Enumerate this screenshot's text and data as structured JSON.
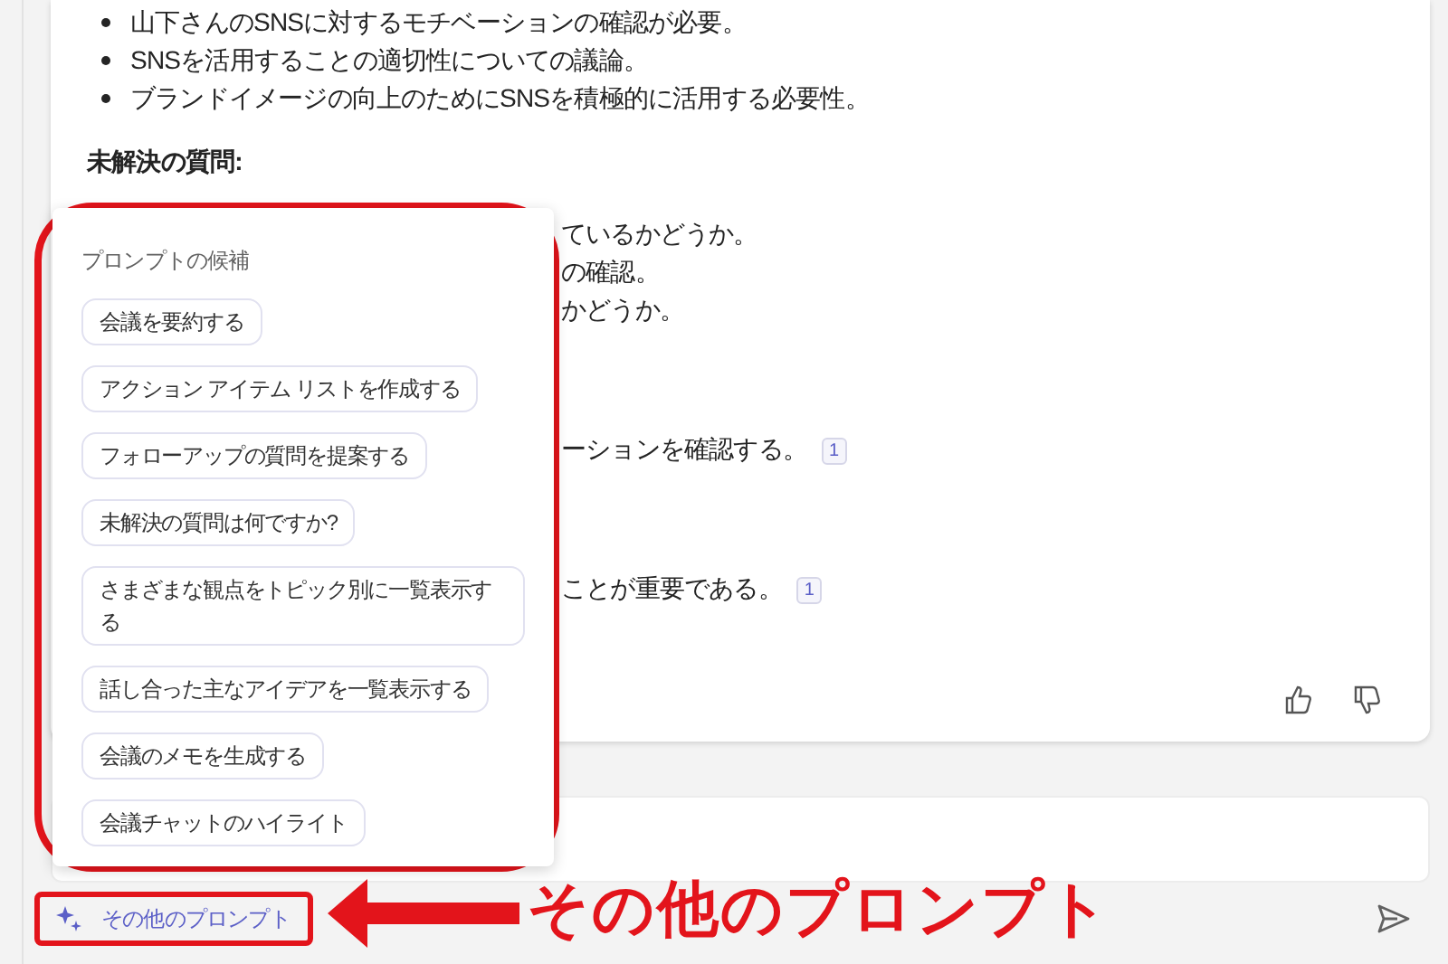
{
  "message": {
    "lines": [
      {
        "kind": "bullet",
        "text": "山下さんのSNSに対するモチベーションの確認が必要。"
      },
      {
        "kind": "bullet",
        "text": "SNSを活用することの適切性についての議論。"
      },
      {
        "kind": "bullet",
        "text": "ブランドイメージの向上のためにSNSを積極的に活用する必要性。"
      },
      {
        "kind": "heading",
        "text": "未解決の質問:"
      },
      {
        "kind": "fragment",
        "text": "ているかどうか。"
      },
      {
        "kind": "fragment",
        "text": "の確認。"
      },
      {
        "kind": "fragment",
        "text": "かどうか。"
      },
      {
        "kind": "fragment",
        "text": "ーションを確認する。",
        "citation": "1"
      },
      {
        "kind": "fragment",
        "text": "ことが重要である。",
        "citation": "1"
      }
    ]
  },
  "prompt_suggestions": {
    "title": "プロンプトの候補",
    "chips": [
      "会議を要約する",
      "アクション アイテム リストを作成する",
      "フォローアップの質問を提案する",
      "未解決の質問は何ですか?",
      "さまざまな観点をトピック別に一覧表示する",
      "話し合った主なアイデアを一覧表示する",
      "会議のメモを生成する",
      "会議チャットのハイライト"
    ]
  },
  "compose": {
    "more_prompts_button": "その他のプロンプト"
  },
  "annotation": {
    "callout": "その他のプロンプト"
  }
}
